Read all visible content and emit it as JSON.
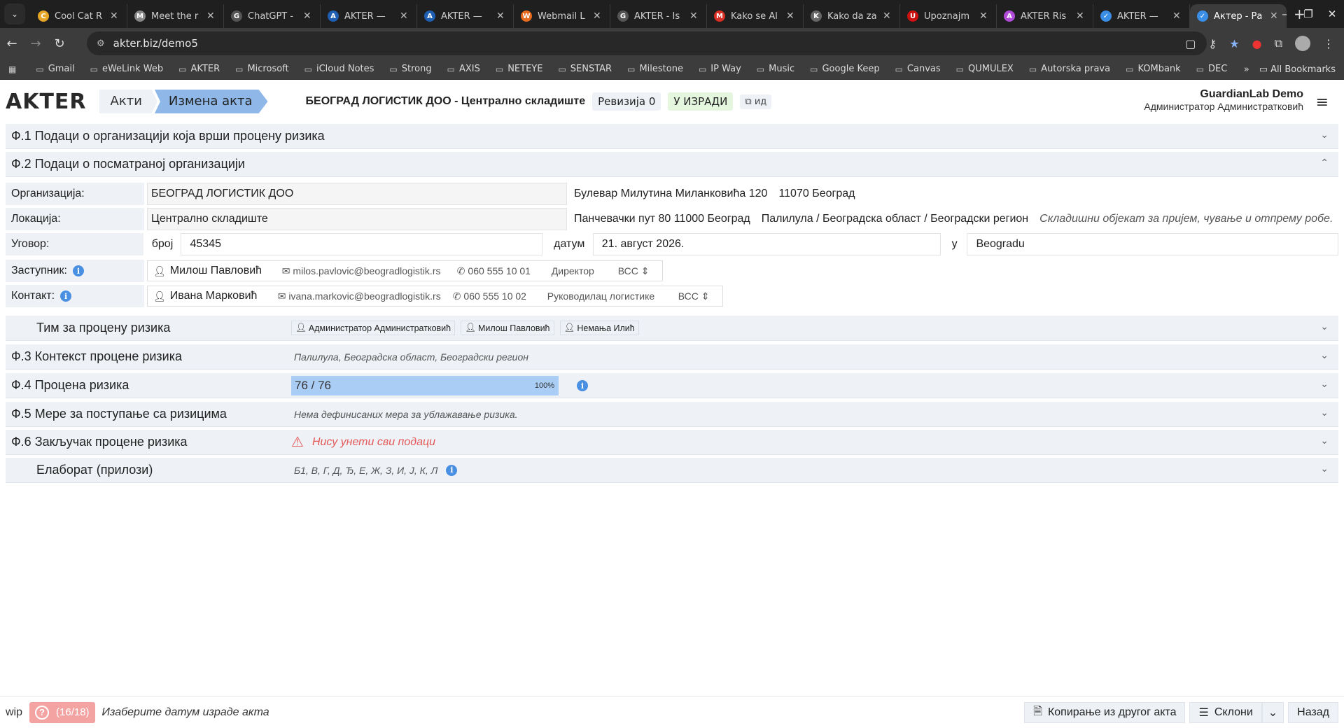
{
  "browser": {
    "tabs": [
      {
        "title": "Cool Cat R",
        "color": "#e8a628",
        "glyph": "C"
      },
      {
        "title": "Meet the r",
        "color": "#888888",
        "glyph": "M"
      },
      {
        "title": "ChatGPT -",
        "color": "#555555",
        "glyph": "G"
      },
      {
        "title": "AKTER —",
        "color": "#1f5fb3",
        "glyph": "A"
      },
      {
        "title": "AKTER —",
        "color": "#1f5fb3",
        "glyph": "A"
      },
      {
        "title": "Webmail L",
        "color": "#e86a1c",
        "glyph": "W"
      },
      {
        "title": "AKTER - Is",
        "color": "#555555",
        "glyph": "G"
      },
      {
        "title": "Kako se Al",
        "color": "#d93025",
        "glyph": "M"
      },
      {
        "title": "Kako da za",
        "color": "#666666",
        "glyph": "K"
      },
      {
        "title": "Upoznajm",
        "color": "#cc1111",
        "glyph": "U"
      },
      {
        "title": "AKTER Ris",
        "color": "#b04ad8",
        "glyph": "A"
      },
      {
        "title": "AKTER —",
        "color": "#3a8ee6",
        "glyph": "✓"
      },
      {
        "title": "Актер - Ра",
        "color": "#3a8ee6",
        "glyph": "✓"
      }
    ],
    "url": "akter.biz/demo5",
    "bookmarks": [
      "Gmail",
      "eWeLink Web",
      "AKTER",
      "Microsoft",
      "iCloud Notes",
      "Strong",
      "AXIS",
      "NETEYE",
      "SENSTAR",
      "Milestone",
      "IP Way",
      "Music",
      "Google Keep",
      "Canvas",
      "QUMULEX",
      "Autorska prava",
      "KOMbank",
      "DEC"
    ],
    "all_bookmarks": "All Bookmarks"
  },
  "header": {
    "logo": "AKTER",
    "crumb_acts": "Акти",
    "crumb_edit": "Измена акта",
    "act_title": "БЕОГРАД ЛОГИСТИК ДОО - Централно складиште",
    "revision": "Ревизија 0",
    "status": "У ИЗРАДИ",
    "id_label": "ид",
    "user_name": "GuardianLab Demo",
    "user_role": "Администратор Администратковић"
  },
  "sections": {
    "f1": "Ф.1 Подаци о организацији која врши процену ризика",
    "f2": "Ф.2 Подаци о посматраној организацији",
    "team": "Тим за процену ризика",
    "f3": "Ф.3 Контекст процене ризика",
    "f3_info": "Палилула, Београдска област, Београдски регион",
    "f4": "Ф.4 Процена ризика",
    "f4_progress_text": "76 / 76",
    "f4_percent": "100%",
    "f4_progress_fraction": 1.0,
    "f5": "Ф.5 Мере за поступање са ризицима",
    "f5_info": "Нема дефинисаних мера за ублажавање ризика.",
    "f6": "Ф.6 Закључак процене ризика",
    "f6_warning": "Нису унети сви подаци",
    "elaborat": "Елаборат (прилози)",
    "elaborat_info": "Б1, В, Г, Д, Ђ, Е, Ж, З, И, Ј, К, Л"
  },
  "team_members": [
    "Администратор Администратковић",
    "Милош Павловић",
    "Немања Илић"
  ],
  "form": {
    "org_label": "Организација:",
    "org_value": "БЕОГРАД ЛОГИСТИК ДОО",
    "org_address": "Булевар Милутина Миланковића 120",
    "org_city": "11070 Београд",
    "loc_label": "Локација:",
    "loc_value": "Централно складиште",
    "loc_address": "Панчевачки пут 80 11000 Београд",
    "loc_region": "Палилула / Београдска област / Београдски регион",
    "loc_desc": "Складишни објекат за пријем, чување и отпрему робе.",
    "contract_label": "Уговор:",
    "contract_no_label": "број",
    "contract_no": "45345",
    "contract_date_label": "датум",
    "contract_date": "21. август 2026.",
    "contract_place_label": "у",
    "contract_place": "Beogradu",
    "rep_label": "Заступник:",
    "rep_name": "Милош Павловић",
    "rep_email": "milos.pavlovic@beogradlogistik.rs",
    "rep_phone": "060 555 10 01",
    "rep_role": "Директор",
    "rep_level": "ВСС",
    "contact_label": "Контакт:",
    "contact_name": "Ивана Марковић",
    "contact_email": "ivana.markovic@beogradlogistik.rs",
    "contact_phone": "060 555 10 02",
    "contact_role": "Руководилац логистике",
    "contact_level": "ВСС"
  },
  "footer": {
    "wip": "wip",
    "progress": "(16/18)",
    "hint": "Изаберите датум израде акта",
    "copy_button": "Копирање из другог акта",
    "collapse_button": "Склони",
    "back_button": "Назад"
  }
}
